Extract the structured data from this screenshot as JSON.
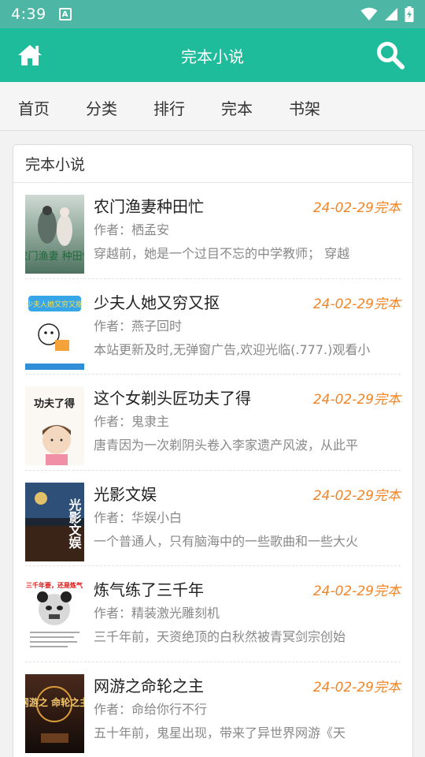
{
  "status_bar": {
    "time": "4:39",
    "notification_icon": "A"
  },
  "header": {
    "title": "完本小说"
  },
  "nav": {
    "items": [
      {
        "label": "首页"
      },
      {
        "label": "分类"
      },
      {
        "label": "排行"
      },
      {
        "label": "完本"
      },
      {
        "label": "书架"
      }
    ]
  },
  "panel": {
    "title": "完本小说"
  },
  "books": [
    {
      "title": "农门渔妻种田忙",
      "date": "24-02-29完本",
      "author": "作者：栖孟安",
      "desc": "穿越前，她是一个过目不忘的中学教师； 穿越",
      "cover_text": "农门渔妻 种田忙"
    },
    {
      "title": "少夫人她又穷又抠",
      "date": "24-02-29完本",
      "author": "作者：燕子回时",
      "desc": "本站更新及时,无弹窗广告,欢迎光临(.777.)观看小",
      "cover_text": "少夫人她又穷又抠"
    },
    {
      "title": "这个女剃头匠功夫了得",
      "date": "24-02-29完本",
      "author": "作者：鬼隶主",
      "desc": "唐青因为一次剃阴头卷入李家遗产风波，从此平",
      "cover_text": "功夫了得"
    },
    {
      "title": "光影文娱",
      "date": "24-02-29完本",
      "author": "作者：华娱小白",
      "desc": "一个普通人，只有脑海中的一些歌曲和一些大火",
      "cover_text": "光影文娱"
    },
    {
      "title": "炼气练了三千年",
      "date": "24-02-29完本",
      "author": "作者：精装激光雕刻机",
      "desc": "三千年前，天资绝顶的白秋然被青冥剑宗创始",
      "cover_text": "三千年要，还是炼气"
    },
    {
      "title": "网游之命轮之主",
      "date": "24-02-29完本",
      "author": "作者：命给你行不行",
      "desc": "五十年前，鬼星出现，带来了异世界网游《天",
      "cover_text": "网游之 命轮之主"
    }
  ]
}
